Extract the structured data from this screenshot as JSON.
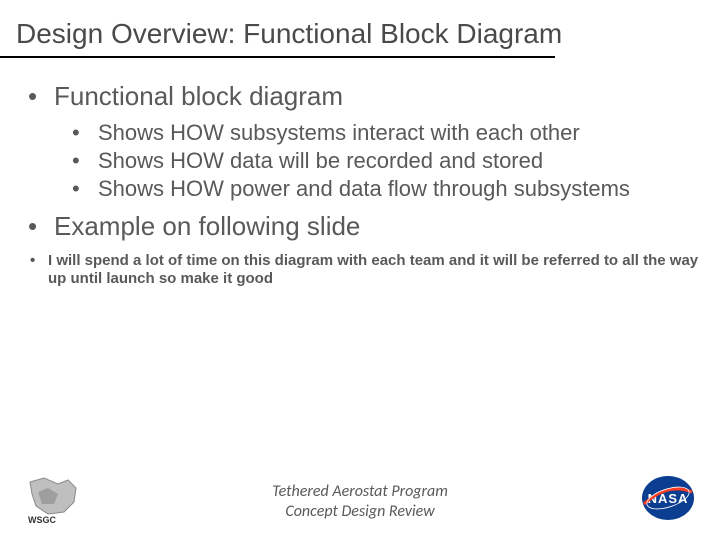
{
  "title": "Design Overview: Functional Block Diagram",
  "bullets": {
    "b1": "Functional block diagram",
    "b1_subs": {
      "s1": "Shows HOW  subsystems interact with each other",
      "s2": "Shows HOW data will be recorded and stored",
      "s3": "Shows HOW power and data flow through subsystems"
    },
    "b2": "Example on following slide"
  },
  "note": "I will spend a lot of time on this diagram with each team and it will be referred to all the way up until launch so make it good",
  "footer": {
    "line1": "Tethered Aerostat Program",
    "line2": "Concept Design Review"
  },
  "logos": {
    "left_name": "WSGC",
    "right_name": "NASA"
  },
  "colors": {
    "text": "#595959",
    "underline": "#000000",
    "nasa_blue": "#0b3d91",
    "nasa_red": "#fc3d21"
  }
}
